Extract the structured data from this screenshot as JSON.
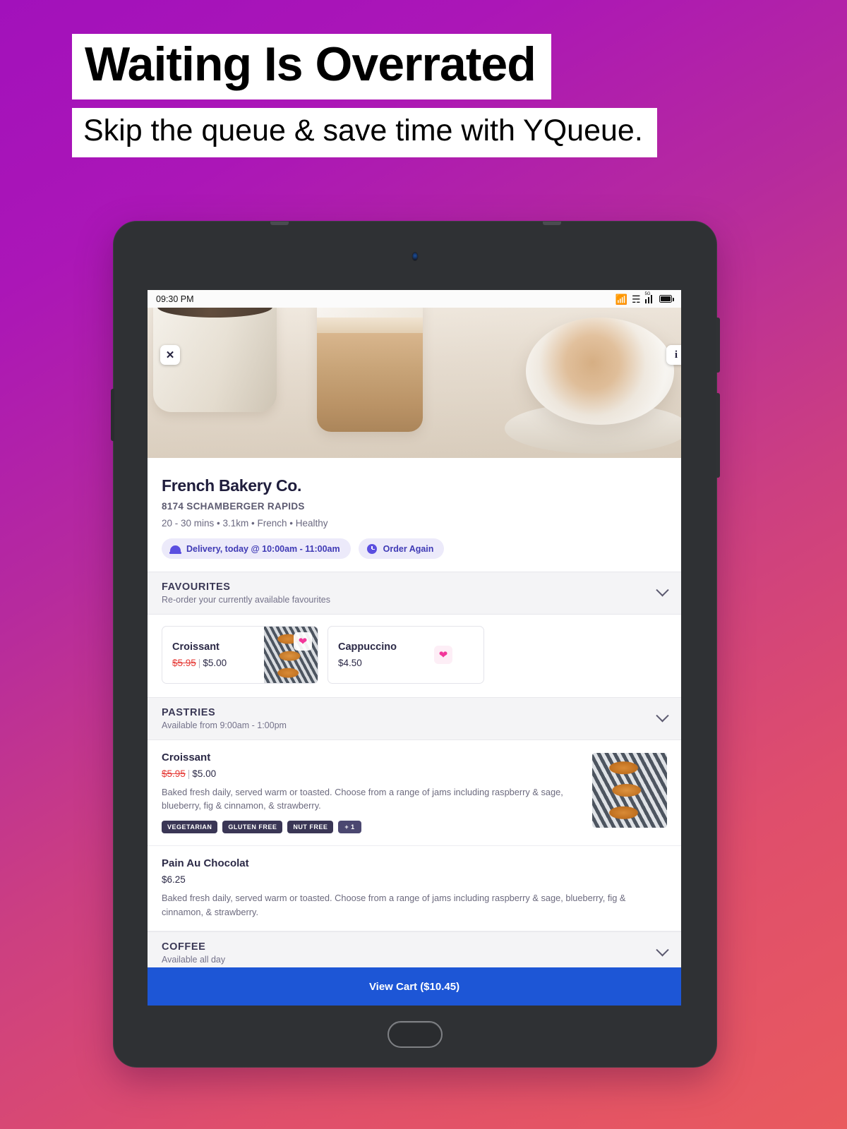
{
  "promo": {
    "title": "Waiting Is Overrated",
    "subtitle": "Skip the queue & save time with YQueue."
  },
  "device": {
    "statusbar": {
      "time": "09:30 PM",
      "icons": [
        "bluetooth-icon",
        "wifi-icon",
        "cellular-5g-icon",
        "battery-icon"
      ],
      "network_label": "5G"
    },
    "home_button": "home-button"
  },
  "hero": {
    "close_label": "✕",
    "info_label": "i"
  },
  "restaurant": {
    "name": "French Bakery Co.",
    "address": "8174 SCHAMBERGER RAPIDS",
    "meta": "20 - 30 mins • 3.1km • French • Healthy",
    "chips": [
      {
        "icon": "delivery-dome-icon",
        "label": "Delivery, today @ 10:00am - 11:00am"
      },
      {
        "icon": "clock-icon",
        "label": "Order Again"
      }
    ]
  },
  "sections": [
    {
      "title": "FAVOURITES",
      "subtitle": "Re-order your currently available favourites",
      "favourites": [
        {
          "name": "Croissant",
          "old_price": "$5.95",
          "price": "$5.00",
          "has_image": true,
          "favourite": true
        },
        {
          "name": "Cappuccino",
          "price": "$4.50",
          "has_image": false,
          "favourite": true
        }
      ]
    },
    {
      "title": "PASTRIES",
      "subtitle": "Available from 9:00am - 1:00pm",
      "items": [
        {
          "name": "Croissant",
          "old_price": "$5.95",
          "price": "$5.00",
          "description": "Baked fresh daily, served warm or toasted. Choose from a range of jams including raspberry & sage, blueberry, fig & cinnamon, & strawberry.",
          "tags": [
            "VEGETARIAN",
            "GLUTEN FREE",
            "NUT FREE",
            "+ 1"
          ],
          "has_image": true
        },
        {
          "name": "Pain Au Chocolat",
          "price": "$6.25",
          "description": "Baked fresh daily, served warm or toasted. Choose from a range of jams including raspberry & sage, blueberry, fig & cinnamon, & strawberry.",
          "tags": [],
          "has_image": false
        }
      ]
    },
    {
      "title": "COFFEE",
      "subtitle": "Available all day",
      "items": []
    }
  ],
  "cart": {
    "label": "View Cart ($10.45)"
  },
  "colors": {
    "brand_purple": "#5b4fe0",
    "cart_blue": "#1d56d6",
    "heart_pink": "#f2379a",
    "sale_red": "#e53935",
    "bg_gradient_start": "#a211bb",
    "bg_gradient_end": "#e95a5e"
  }
}
